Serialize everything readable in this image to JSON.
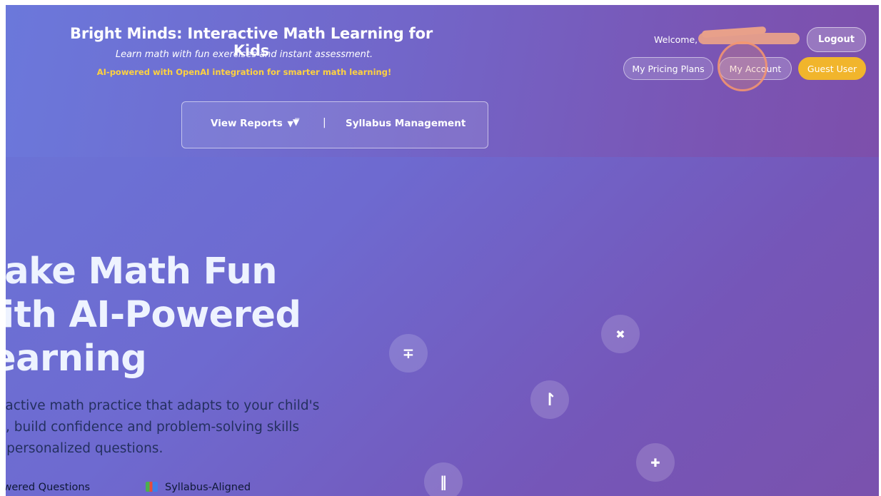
{
  "header": {
    "title": "Bright Minds: Interactive Math Learning for Kids",
    "subtitle": "Learn math with fun exercises and instant assessment.",
    "ai_note": "AI-powered with OpenAI integration for smarter math learning!",
    "nav": {
      "reports_label": "View Reports",
      "reports_caret": "▼",
      "filter_icon": "▼̅",
      "separator": "|",
      "syllabus_label": "Syllabus Management"
    },
    "user": {
      "welcome_text": "Welcome,",
      "logout_label": "Logout",
      "pricing_label": "My Pricing Plans",
      "account_label": "My Account",
      "guest_label": "Guest User"
    }
  },
  "hero": {
    "title_lines": [
      "Make Math Fun",
      "with AI-Powered",
      "Learning"
    ],
    "desc_lines": [
      "Interactive math practice that adapts to your child's",
      "level, build confidence and problem-solving skills",
      "with personalized questions."
    ],
    "features": [
      "AI-Powered Questions",
      "Syllabus-Aligned"
    ]
  },
  "bubbles": {
    "icons": [
      "∓",
      "✖",
      "↾",
      "✚",
      "‖"
    ]
  },
  "colors": {
    "accent_yellow": "#f1b52c",
    "ai_note": "#ffd23f",
    "cursor": "#f5966e"
  }
}
